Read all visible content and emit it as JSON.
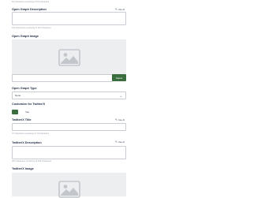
{
  "top_hint": "60 characters remaining of 60 characters",
  "og_description": {
    "label": "Open Graph Description",
    "edit_label": "Use AI",
    "value": "",
    "hint": "110 characters remaining of 110 characters"
  },
  "og_image": {
    "label": "Open Graph Image",
    "url_value": "",
    "select_label": "Select"
  },
  "og_type": {
    "label": "Open Graph Type",
    "selected": "None"
  },
  "twitter_customize": {
    "label": "Customize for Twitter/X",
    "toggle_text": "Yes"
  },
  "twitter_title": {
    "label": "Twitter/X Title",
    "edit_label": "Use AI",
    "value": "",
    "hint": "70 characters remaining of 70 characters"
  },
  "twitter_description": {
    "label": "Twitter/X Description",
    "edit_label": "Use AI",
    "value": "",
    "hint": "200 characters remaining of 200 characters"
  },
  "twitter_image": {
    "label": "Twitter/X Image"
  },
  "colors": {
    "accent": "#3b6e3f",
    "label": "#1f2a44",
    "hint": "#9aa3ad",
    "image_bg": "#eceef0"
  }
}
